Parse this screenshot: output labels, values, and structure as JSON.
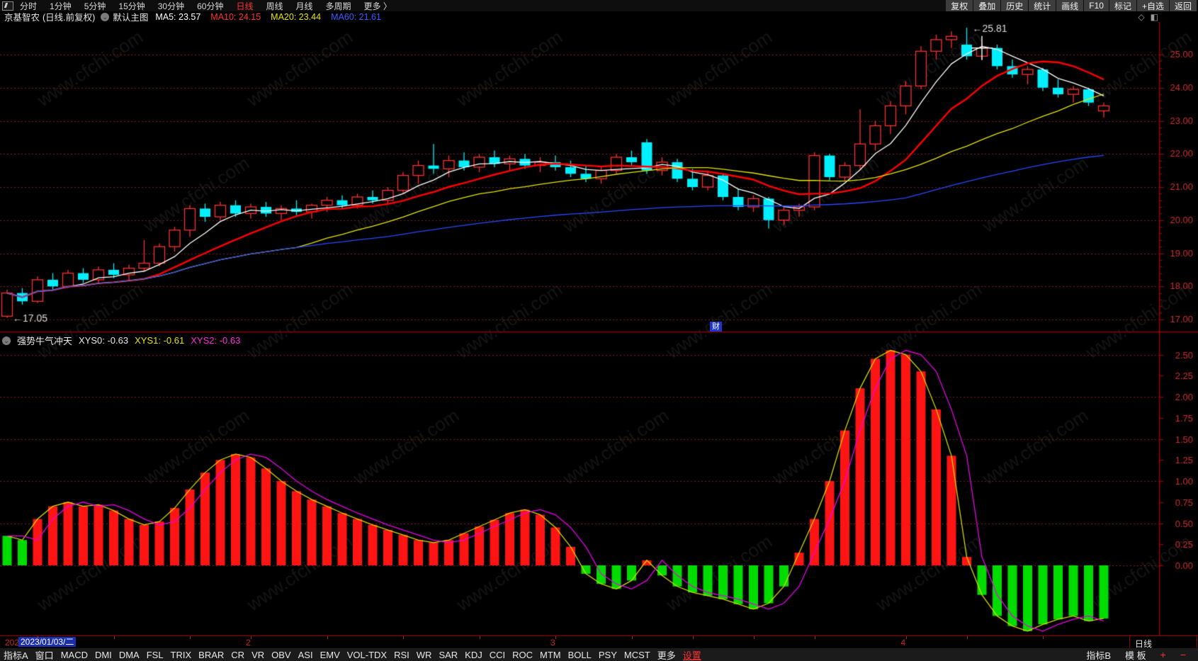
{
  "toolbar_top": {
    "left_items": [
      {
        "label": "分时",
        "name": "realtime"
      },
      {
        "label": "1分钟",
        "name": "1min"
      },
      {
        "label": "5分钟",
        "name": "5min"
      },
      {
        "label": "15分钟",
        "name": "15min"
      },
      {
        "label": "30分钟",
        "name": "30min"
      },
      {
        "label": "60分钟",
        "name": "60min"
      },
      {
        "label": "日线",
        "name": "daily",
        "active": true
      },
      {
        "label": "周线",
        "name": "weekly"
      },
      {
        "label": "月线",
        "name": "monthly"
      },
      {
        "label": "多周期",
        "name": "multi-period"
      },
      {
        "label": "更多 〉",
        "name": "more"
      }
    ],
    "right_items": [
      {
        "label": "复权",
        "name": "adjust"
      },
      {
        "label": "叠加",
        "name": "overlay"
      },
      {
        "label": "历史",
        "name": "history"
      },
      {
        "label": "统计",
        "name": "statistics"
      },
      {
        "label": "画线",
        "name": "draw-line"
      },
      {
        "label": "F10",
        "name": "f10"
      },
      {
        "label": "标记",
        "name": "mark"
      },
      {
        "label": "+自选",
        "name": "add-watchlist"
      },
      {
        "label": "返回",
        "name": "back"
      }
    ]
  },
  "header": {
    "symbol": "京基智农",
    "mode": "(日线.前复权)",
    "chart_type": "默认主图",
    "dropdown_icon": "⌄",
    "ma_labels": [
      {
        "label": "MA5: 23.57",
        "color": "#ffffff"
      },
      {
        "label": "MA10: 24.15",
        "color": "#ff3232"
      },
      {
        "label": "MA20: 23.44",
        "color": "#e6e600"
      },
      {
        "label": "MA60: 21.61",
        "color": "#3c5cff"
      }
    ],
    "right_icons": {
      "diamond": "◇",
      "window": "◧"
    }
  },
  "indicator_header": {
    "name": "强势牛气冲天",
    "dropdown_icon": "⌄",
    "values": [
      {
        "label": "XYS0: -0.63",
        "color": "#e8e8e8"
      },
      {
        "label": "XYS1: -0.61",
        "color": "#e6e600"
      },
      {
        "label": "XYS2: -0.63",
        "color": "#ff2ad9"
      }
    ]
  },
  "badge": "财",
  "watermark": "www.cfchi.com",
  "bottom": {
    "year_partial": "202",
    "date_label": "2023/01/03/二",
    "period_label": "日线",
    "months": [
      {
        "label": "2",
        "idx": 16
      },
      {
        "label": "3",
        "idx": 36
      },
      {
        "label": "4",
        "idx": 59
      }
    ],
    "week_ticks": [
      2,
      7,
      12,
      21,
      26,
      31,
      41,
      45,
      49,
      53,
      63,
      68
    ]
  },
  "toolbar_bottom": {
    "left_items": [
      {
        "label": "指标A",
        "name": "indicator-a"
      },
      {
        "label": "窗口",
        "name": "window"
      },
      {
        "label": "MACD",
        "name": "macd"
      },
      {
        "label": "DMI",
        "name": "dmi"
      },
      {
        "label": "DMA",
        "name": "dma"
      },
      {
        "label": "FSL",
        "name": "fsl"
      },
      {
        "label": "TRIX",
        "name": "trix"
      },
      {
        "label": "BRAR",
        "name": "brar"
      },
      {
        "label": "CR",
        "name": "cr"
      },
      {
        "label": "VR",
        "name": "vr"
      },
      {
        "label": "OBV",
        "name": "obv"
      },
      {
        "label": "ASI",
        "name": "asi"
      },
      {
        "label": "EMV",
        "name": "emv"
      },
      {
        "label": "VOL-TDX",
        "name": "vol-tdx"
      },
      {
        "label": "RSI",
        "name": "rsi"
      },
      {
        "label": "WR",
        "name": "wr"
      },
      {
        "label": "SAR",
        "name": "sar"
      },
      {
        "label": "KDJ",
        "name": "kdj"
      },
      {
        "label": "CCI",
        "name": "cci"
      },
      {
        "label": "ROC",
        "name": "roc"
      },
      {
        "label": "MTM",
        "name": "mtm"
      },
      {
        "label": "BOLL",
        "name": "boll"
      },
      {
        "label": "PSY",
        "name": "psy"
      },
      {
        "label": "MCST",
        "name": "mcst"
      },
      {
        "label": "更多",
        "name": "more"
      },
      {
        "label": "设置",
        "name": "settings",
        "cls": "settings"
      }
    ],
    "right_items": [
      {
        "label": "指标B",
        "name": "indicator-b"
      },
      {
        "label": "模 板",
        "name": "template"
      },
      {
        "label": "+",
        "name": "zoom-in",
        "cls": "plus"
      },
      {
        "label": "−",
        "name": "zoom-out",
        "cls": "minus"
      }
    ]
  },
  "chart_data": [
    {
      "type": "candlestick",
      "title": "京基智农 日线 前复权",
      "start_date": "2023/01/03",
      "ylim": [
        16.85,
        25.95
      ],
      "yticks": [
        17,
        18,
        19,
        20,
        21,
        22,
        23,
        24,
        25
      ],
      "grid": "dotted-red",
      "up_color": "#ff3030",
      "down_color": "#00f0ff",
      "ma_windows": [
        5,
        10,
        20,
        60
      ],
      "ma_colors": [
        "#ffffff",
        "#ff0000",
        "#e6e600",
        "#2948ff"
      ],
      "candles": [
        [
          17.1,
          17.9,
          17.05,
          17.8
        ],
        [
          17.8,
          17.95,
          17.45,
          17.55
        ],
        [
          17.55,
          18.3,
          17.5,
          18.2
        ],
        [
          18.2,
          18.4,
          17.9,
          18.0
        ],
        [
          18.0,
          18.5,
          17.95,
          18.4
        ],
        [
          18.4,
          18.55,
          18.1,
          18.2
        ],
        [
          18.2,
          18.6,
          18.1,
          18.5
        ],
        [
          18.5,
          18.7,
          18.25,
          18.35
        ],
        [
          18.35,
          18.65,
          18.2,
          18.55
        ],
        [
          18.55,
          19.4,
          18.45,
          18.7
        ],
        [
          18.7,
          19.3,
          18.6,
          19.2
        ],
        [
          19.2,
          19.8,
          19.05,
          19.7
        ],
        [
          19.7,
          20.45,
          19.5,
          20.35
        ],
        [
          20.35,
          20.5,
          19.95,
          20.1
        ],
        [
          20.1,
          20.55,
          20.0,
          20.45
        ],
        [
          20.45,
          20.6,
          20.1,
          20.2
        ],
        [
          20.2,
          20.5,
          20.05,
          20.4
        ],
        [
          20.4,
          20.55,
          20.1,
          20.2
        ],
        [
          20.2,
          20.45,
          20.0,
          20.35
        ],
        [
          20.35,
          20.6,
          20.15,
          20.25
        ],
        [
          20.25,
          20.5,
          20.05,
          20.45
        ],
        [
          20.45,
          20.7,
          20.25,
          20.6
        ],
        [
          20.6,
          20.75,
          20.35,
          20.45
        ],
        [
          20.45,
          20.8,
          20.35,
          20.7
        ],
        [
          20.7,
          20.9,
          20.5,
          20.6
        ],
        [
          20.6,
          21.0,
          20.5,
          20.9
        ],
        [
          20.9,
          21.45,
          20.8,
          21.35
        ],
        [
          21.35,
          21.8,
          21.1,
          21.65
        ],
        [
          21.65,
          22.3,
          21.4,
          21.55
        ],
        [
          21.55,
          21.95,
          21.3,
          21.8
        ],
        [
          21.8,
          22.05,
          21.5,
          21.6
        ],
        [
          21.6,
          22.0,
          21.45,
          21.9
        ],
        [
          21.9,
          22.1,
          21.6,
          21.7
        ],
        [
          21.7,
          21.95,
          21.5,
          21.85
        ],
        [
          21.85,
          22.0,
          21.55,
          21.65
        ],
        [
          21.65,
          21.9,
          21.45,
          21.75
        ],
        [
          21.75,
          21.95,
          21.5,
          21.6
        ],
        [
          21.6,
          21.8,
          21.3,
          21.4
        ],
        [
          21.4,
          21.65,
          21.15,
          21.25
        ],
        [
          21.25,
          21.6,
          21.1,
          21.5
        ],
        [
          21.5,
          22.0,
          21.4,
          21.9
        ],
        [
          21.9,
          22.1,
          21.65,
          21.75
        ],
        [
          22.35,
          22.45,
          21.4,
          21.5
        ],
        [
          21.5,
          21.9,
          21.35,
          21.75
        ],
        [
          21.75,
          21.85,
          21.15,
          21.25
        ],
        [
          21.25,
          21.55,
          20.9,
          21.0
        ],
        [
          21.0,
          21.45,
          20.9,
          21.35
        ],
        [
          21.35,
          21.4,
          20.6,
          20.7
        ],
        [
          20.7,
          20.95,
          20.3,
          20.4
        ],
        [
          20.4,
          20.75,
          20.25,
          20.65
        ],
        [
          20.65,
          20.7,
          19.75,
          20.0
        ],
        [
          20.0,
          20.4,
          19.85,
          20.3
        ],
        [
          20.3,
          20.5,
          20.1,
          20.4
        ],
        [
          20.4,
          22.05,
          20.3,
          21.95
        ],
        [
          21.95,
          22.0,
          21.2,
          21.3
        ],
        [
          21.3,
          21.75,
          21.2,
          21.65
        ],
        [
          21.65,
          23.35,
          21.55,
          22.3
        ],
        [
          22.3,
          23.0,
          22.1,
          22.85
        ],
        [
          22.85,
          23.6,
          22.6,
          23.45
        ],
        [
          23.45,
          24.2,
          23.2,
          24.05
        ],
        [
          24.05,
          25.25,
          23.95,
          25.1
        ],
        [
          25.1,
          25.6,
          24.85,
          25.45
        ],
        [
          25.45,
          25.7,
          25.2,
          25.55
        ],
        [
          25.3,
          25.81,
          24.85,
          24.95
        ],
        [
          24.95,
          25.35,
          24.85,
          25.2
        ],
        [
          25.2,
          25.3,
          24.55,
          24.65
        ],
        [
          24.65,
          24.85,
          24.3,
          24.4
        ],
        [
          24.4,
          24.65,
          24.1,
          24.55
        ],
        [
          24.55,
          24.6,
          23.9,
          24.0
        ],
        [
          24.0,
          24.25,
          23.7,
          23.8
        ],
        [
          23.8,
          24.05,
          23.55,
          23.95
        ],
        [
          23.95,
          24.0,
          23.45,
          23.55
        ],
        [
          23.3,
          23.55,
          23.1,
          23.45
        ]
      ],
      "annotations": [
        {
          "text": "←25.81",
          "idx": 63,
          "price": 25.81
        },
        {
          "text": "←17.05",
          "idx": 0,
          "price": 17.05
        }
      ],
      "cross_marker": {
        "idx": 64,
        "price": 25.2
      }
    },
    {
      "type": "bar",
      "title": "强势牛气冲天",
      "ylim": [
        -0.95,
        2.7
      ],
      "yticks": [
        0,
        0.25,
        0.5,
        0.75,
        1,
        1.25,
        1.5,
        1.75,
        2,
        2.25,
        2.5
      ],
      "grid_step": 0.5,
      "positive_color": "#ff1414",
      "negative_color": "#00dc00",
      "force_negative_color_idx": [
        0,
        1
      ],
      "line1_color": "#d8d800",
      "line2_color": "#e800e8",
      "values": [
        0.35,
        0.3,
        0.55,
        0.7,
        0.75,
        0.7,
        0.72,
        0.65,
        0.55,
        0.48,
        0.52,
        0.68,
        0.9,
        1.1,
        1.25,
        1.32,
        1.28,
        1.15,
        1.0,
        0.88,
        0.78,
        0.7,
        0.62,
        0.55,
        0.48,
        0.42,
        0.36,
        0.3,
        0.27,
        0.3,
        0.38,
        0.46,
        0.54,
        0.62,
        0.66,
        0.6,
        0.45,
        0.22,
        -0.1,
        -0.22,
        -0.28,
        -0.18,
        0.06,
        -0.12,
        -0.25,
        -0.32,
        -0.36,
        -0.4,
        -0.46,
        -0.52,
        -0.45,
        -0.25,
        0.15,
        0.55,
        1.0,
        1.6,
        2.1,
        2.45,
        2.55,
        2.5,
        2.3,
        1.85,
        1.3,
        0.1,
        -0.35,
        -0.6,
        -0.72,
        -0.78,
        -0.7,
        -0.64,
        -0.6,
        -0.66,
        -0.63
      ]
    }
  ]
}
